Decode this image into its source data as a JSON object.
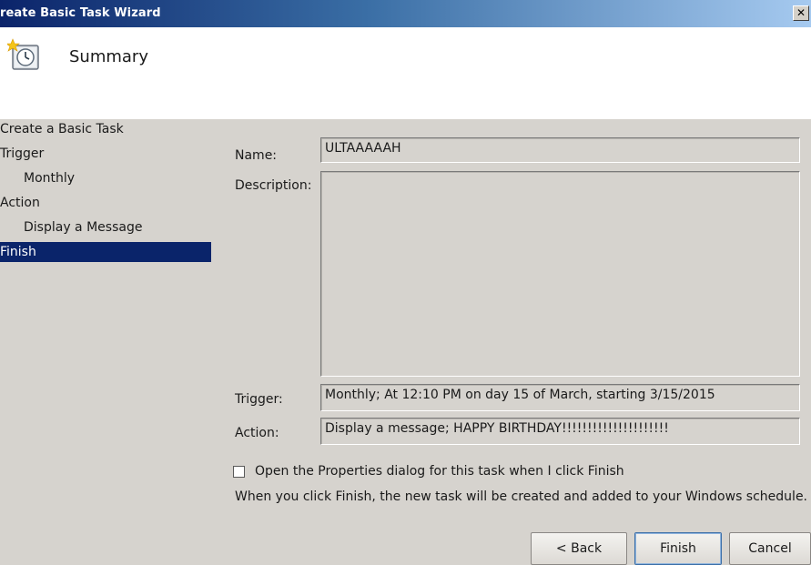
{
  "window": {
    "title": "reate Basic Task Wizard",
    "close_glyph": "✕"
  },
  "header": {
    "title": "Summary",
    "icon": "scheduled-task-clock-icon"
  },
  "nav": {
    "items": [
      {
        "label": "Create a Basic Task",
        "level": 1,
        "selected": false
      },
      {
        "label": "Trigger",
        "level": 1,
        "selected": false
      },
      {
        "label": "Monthly",
        "level": 2,
        "selected": false
      },
      {
        "label": "Action",
        "level": 1,
        "selected": false
      },
      {
        "label": "Display a Message",
        "level": 2,
        "selected": false
      },
      {
        "label": "Finish",
        "level": 1,
        "selected": true
      }
    ]
  },
  "form": {
    "name_label": "Name:",
    "name_value": "ULTAAAAAH",
    "description_label": "Description:",
    "description_value": "",
    "trigger_label": "Trigger:",
    "trigger_value": "Monthly; At 12:10 PM  on day 15 of March, starting 3/15/2015",
    "action_label": "Action:",
    "action_value": "Display a message; HAPPY BIRTHDAY!!!!!!!!!!!!!!!!!!!!!"
  },
  "options": {
    "open_properties_label": "Open the Properties dialog for this task when I click Finish",
    "open_properties_checked": false,
    "info_text": "When you click Finish, the new task will be created and added to your Windows schedule."
  },
  "buttons": {
    "back": "< Back",
    "finish": "Finish",
    "cancel": "Cancel"
  },
  "colors": {
    "title_bar": "#0b246a",
    "selection": "#0a246a",
    "dialog_bg": "#d6d3ce"
  }
}
